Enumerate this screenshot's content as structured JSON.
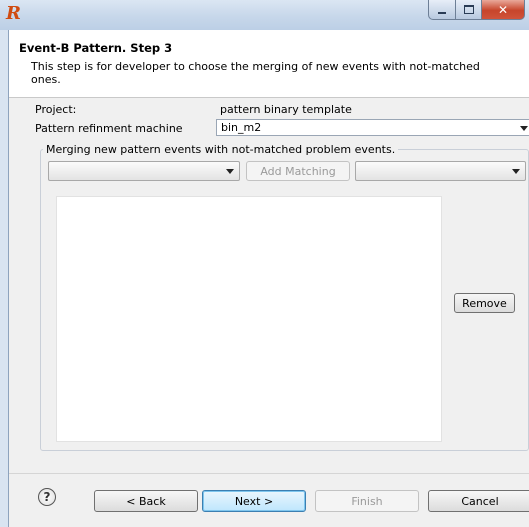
{
  "window": {
    "app_icon_glyph": "R",
    "close_glyph": "✕"
  },
  "header": {
    "title": "Event-B Pattern. Step 3",
    "description": "This step is for developer to choose the merging of new events with not-matched ones."
  },
  "form": {
    "project_label": "Project:",
    "project_value": "pattern binary template",
    "machine_label": "Pattern refinment machine",
    "machine_value": "bin_m2"
  },
  "merging": {
    "group_title": "Merging new pattern events with not-matched problem events.",
    "left_combo_value": "",
    "right_combo_value": "",
    "add_button": "Add Matching",
    "remove_button": "Remove"
  },
  "footer": {
    "help_glyph": "?",
    "back": "< Back",
    "next": "Next >",
    "finish": "Finish",
    "cancel": "Cancel"
  }
}
